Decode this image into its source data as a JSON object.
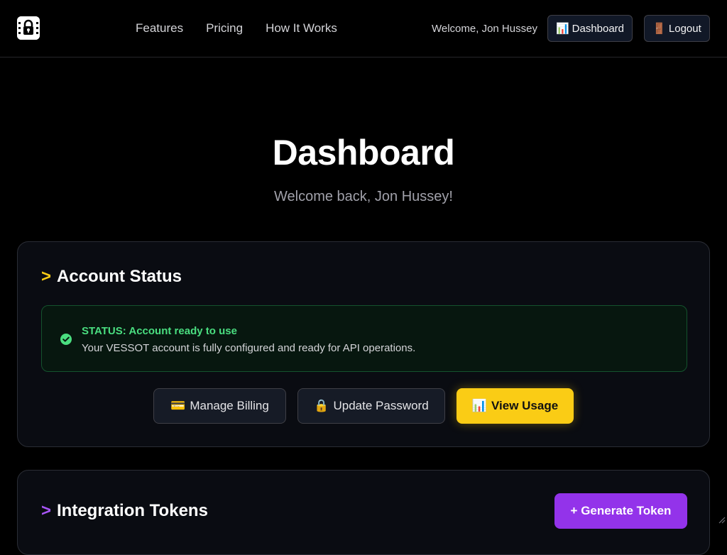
{
  "nav": {
    "logo_icon": "lock-icon",
    "links": [
      "Features",
      "Pricing",
      "How It Works"
    ],
    "welcome": "Welcome, Jon Hussey",
    "dashboard_label": "Dashboard",
    "dashboard_icon": "📊",
    "logout_label": "Logout",
    "logout_icon": "🚪"
  },
  "hero": {
    "title": "Dashboard",
    "subtitle": "Welcome back, Jon Hussey!"
  },
  "account_status": {
    "prompt": ">",
    "title": "Account Status",
    "status_heading": "STATUS: Account ready to use",
    "status_text": "Your VESSOT account is fully configured and ready for API operations.",
    "buttons": {
      "billing_icon": "💳",
      "billing_label": "Manage Billing",
      "password_icon": "🔒",
      "password_label": "Update Password",
      "usage_icon": "📊",
      "usage_label": "View Usage"
    }
  },
  "integration_tokens": {
    "prompt": ">",
    "title": "Integration Tokens",
    "generate_label": "+ Generate Token"
  },
  "colors": {
    "accent_yellow": "#facc15",
    "accent_purple": "#9333ea",
    "success_green": "#4ade80"
  }
}
